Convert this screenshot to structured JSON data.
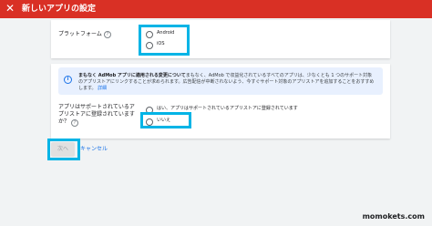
{
  "header": {
    "title": "新しいアプリの設定",
    "close_icon": "close-icon",
    "bar_color": "#d93025"
  },
  "platform": {
    "label": "プラットフォーム",
    "help_icon": "help-circle-icon",
    "options": [
      "Android",
      "iOS"
    ]
  },
  "notice": {
    "icon": "info-icon",
    "bold_text": "まもなく AdMob アプリに適用される変更について",
    "text": "まもなく、AdMob で収益化されているすべてのアプリは、少なくとも 1 つのサポート対象のアプリストアにリンクすることが求められます。広告配信が中断されないよう、今すぐサポート対象のアプリストアを追加することをおすすめします。",
    "link": "詳細"
  },
  "store": {
    "label": "アプリはサポートされているアプリストアに登録されていますか？",
    "help_icon": "help-circle-icon",
    "options": [
      "はい、アプリはサポートされているアプリストアに登録されています",
      "いいえ"
    ]
  },
  "actions": {
    "next": "次へ",
    "cancel": "キャンセル"
  },
  "watermark": "momokets.com",
  "highlight_color": "#00b4e6"
}
